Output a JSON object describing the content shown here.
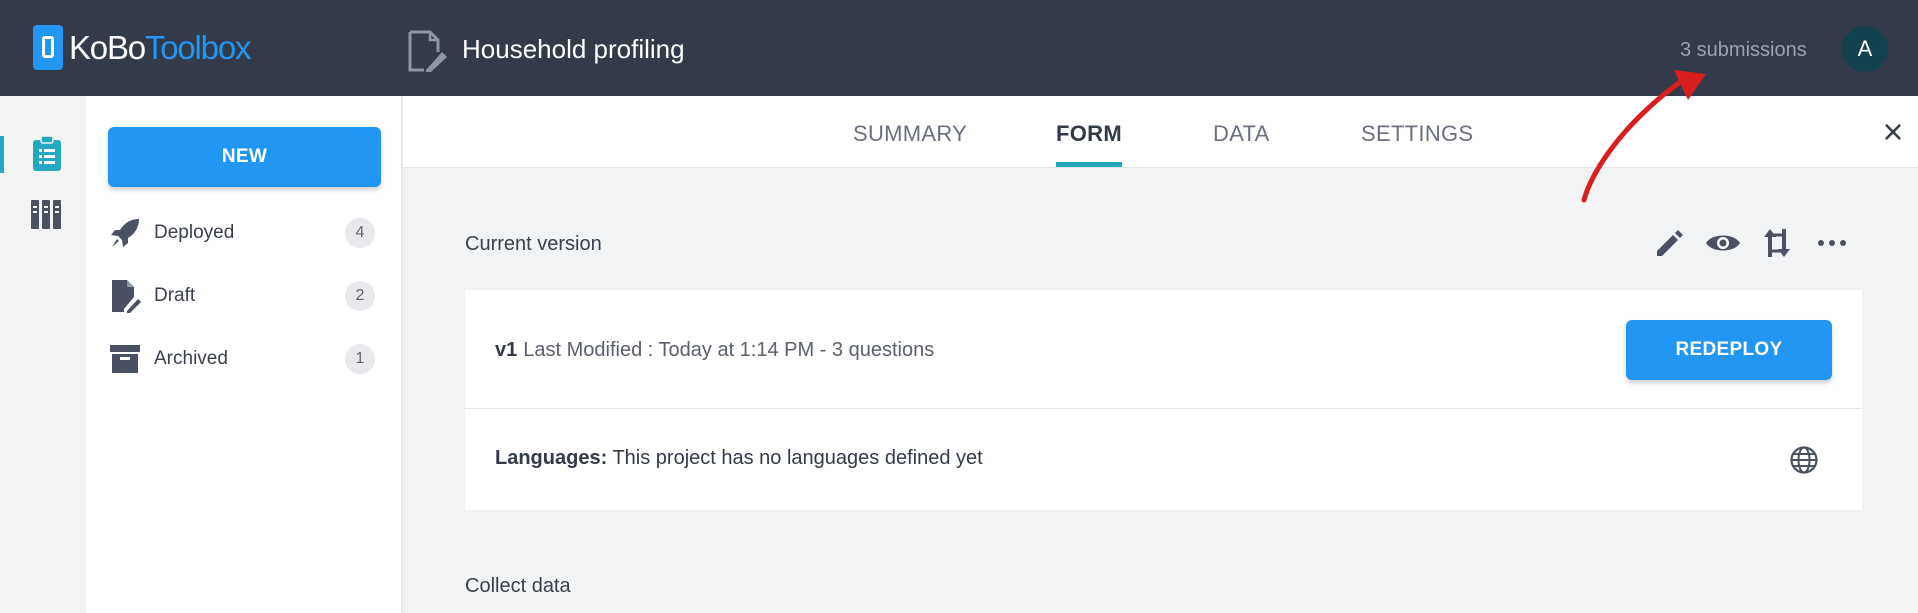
{
  "header": {
    "logo_part1": "KoBo",
    "logo_part2": "Toolbox",
    "project_title": "Household profiling",
    "submissions": "3 submissions",
    "avatar_letter": "A"
  },
  "sidebar": {
    "new_label": "NEW",
    "items": [
      {
        "label": "Deployed",
        "count": "4",
        "icon": "rocket-icon"
      },
      {
        "label": "Draft",
        "count": "2",
        "icon": "draft-file-icon"
      },
      {
        "label": "Archived",
        "count": "1",
        "icon": "archive-box-icon"
      }
    ]
  },
  "tabs": [
    {
      "label": "SUMMARY",
      "active": false
    },
    {
      "label": "FORM",
      "active": true
    },
    {
      "label": "DATA",
      "active": false
    },
    {
      "label": "SETTINGS",
      "active": false
    }
  ],
  "form": {
    "current_version_label": "Current version",
    "version": "v1",
    "version_details": "Last Modified : Today at 1:14 PM - 3 questions",
    "redeploy_label": "REDEPLOY",
    "languages_label": "Languages:",
    "languages_text": "This project has no languages defined yet",
    "collect_data_label": "Collect data"
  },
  "colors": {
    "header_bg": "#333a4a",
    "accent_blue": "#2196f3",
    "accent_teal": "#22a9c1",
    "annotation_red": "#d91e1e"
  }
}
